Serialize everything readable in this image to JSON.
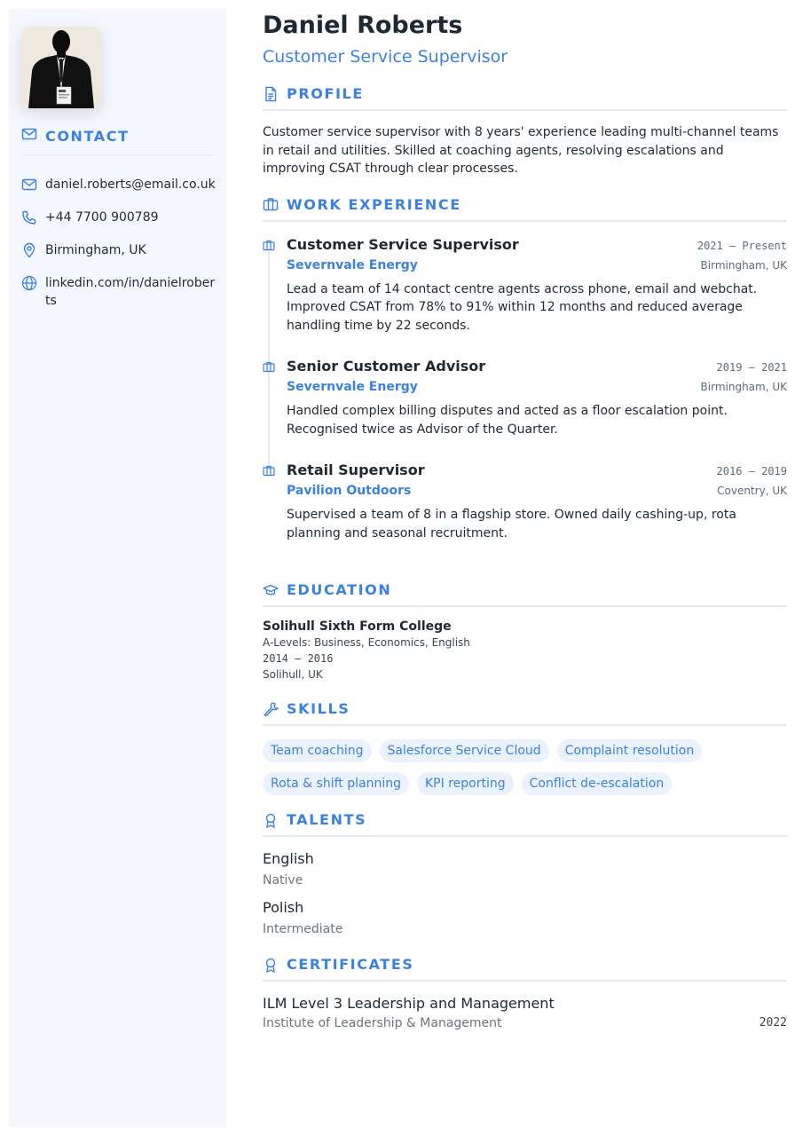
{
  "person": {
    "name": "Daniel Roberts",
    "title": "Customer Service Supervisor"
  },
  "contact": {
    "heading": "CONTACT",
    "email": "daniel.roberts@email.co.uk",
    "phone": "+44 7700 900789",
    "location": "Birmingham, UK",
    "linkedin": "linkedin.com/in/danielroberts"
  },
  "profile": {
    "heading": "PROFILE",
    "text": "Customer service supervisor with 8 years' experience leading multi-channel teams in retail and utilities. Skilled at coaching agents, resolving escalations and improving CSAT through clear processes."
  },
  "experience": {
    "heading": "WORK EXPERIENCE",
    "jobs": [
      {
        "title": "Customer Service Supervisor",
        "dates": "2021 – Present",
        "company": "Severnvale Energy",
        "location": "Birmingham, UK",
        "description": "Lead a team of 14 contact centre agents across phone, email and webchat. Improved CSAT from 78% to 91% within 12 months and reduced average handling time by 22 seconds."
      },
      {
        "title": "Senior Customer Advisor",
        "dates": "2019 – 2021",
        "company": "Severnvale Energy",
        "location": "Birmingham, UK",
        "description": "Handled complex billing disputes and acted as a floor escalation point. Recognised twice as Advisor of the Quarter."
      },
      {
        "title": "Retail Supervisor",
        "dates": "2016 – 2019",
        "company": "Pavilion Outdoors",
        "location": "Coventry, UK",
        "description": "Supervised a team of 8 in a flagship store. Owned daily cashing-up, rota planning and seasonal recruitment."
      }
    ]
  },
  "education": {
    "heading": "EDUCATION",
    "school": "Solihull Sixth Form College",
    "qualification": "A-Levels: Business, Economics, English",
    "dates": "2014 – 2016",
    "location": "Solihull, UK"
  },
  "skills": {
    "heading": "SKILLS",
    "items": [
      "Team coaching",
      "Salesforce Service Cloud",
      "Complaint resolution",
      "Rota & shift planning",
      "KPI reporting",
      "Conflict de-escalation"
    ]
  },
  "talents": {
    "heading": "TALENTS",
    "items": [
      {
        "name": "English",
        "level": "Native"
      },
      {
        "name": "Polish",
        "level": "Intermediate"
      }
    ]
  },
  "certificates": {
    "heading": "CERTIFICATES",
    "items": [
      {
        "name": "ILM Level 3 Leadership and Management",
        "issuer": "Institute of Leadership & Management",
        "year": "2022"
      }
    ]
  },
  "colors": {
    "accent": "#3b82e0",
    "sidebar": "#f4f8fe",
    "chip": "#ebf2fd"
  }
}
